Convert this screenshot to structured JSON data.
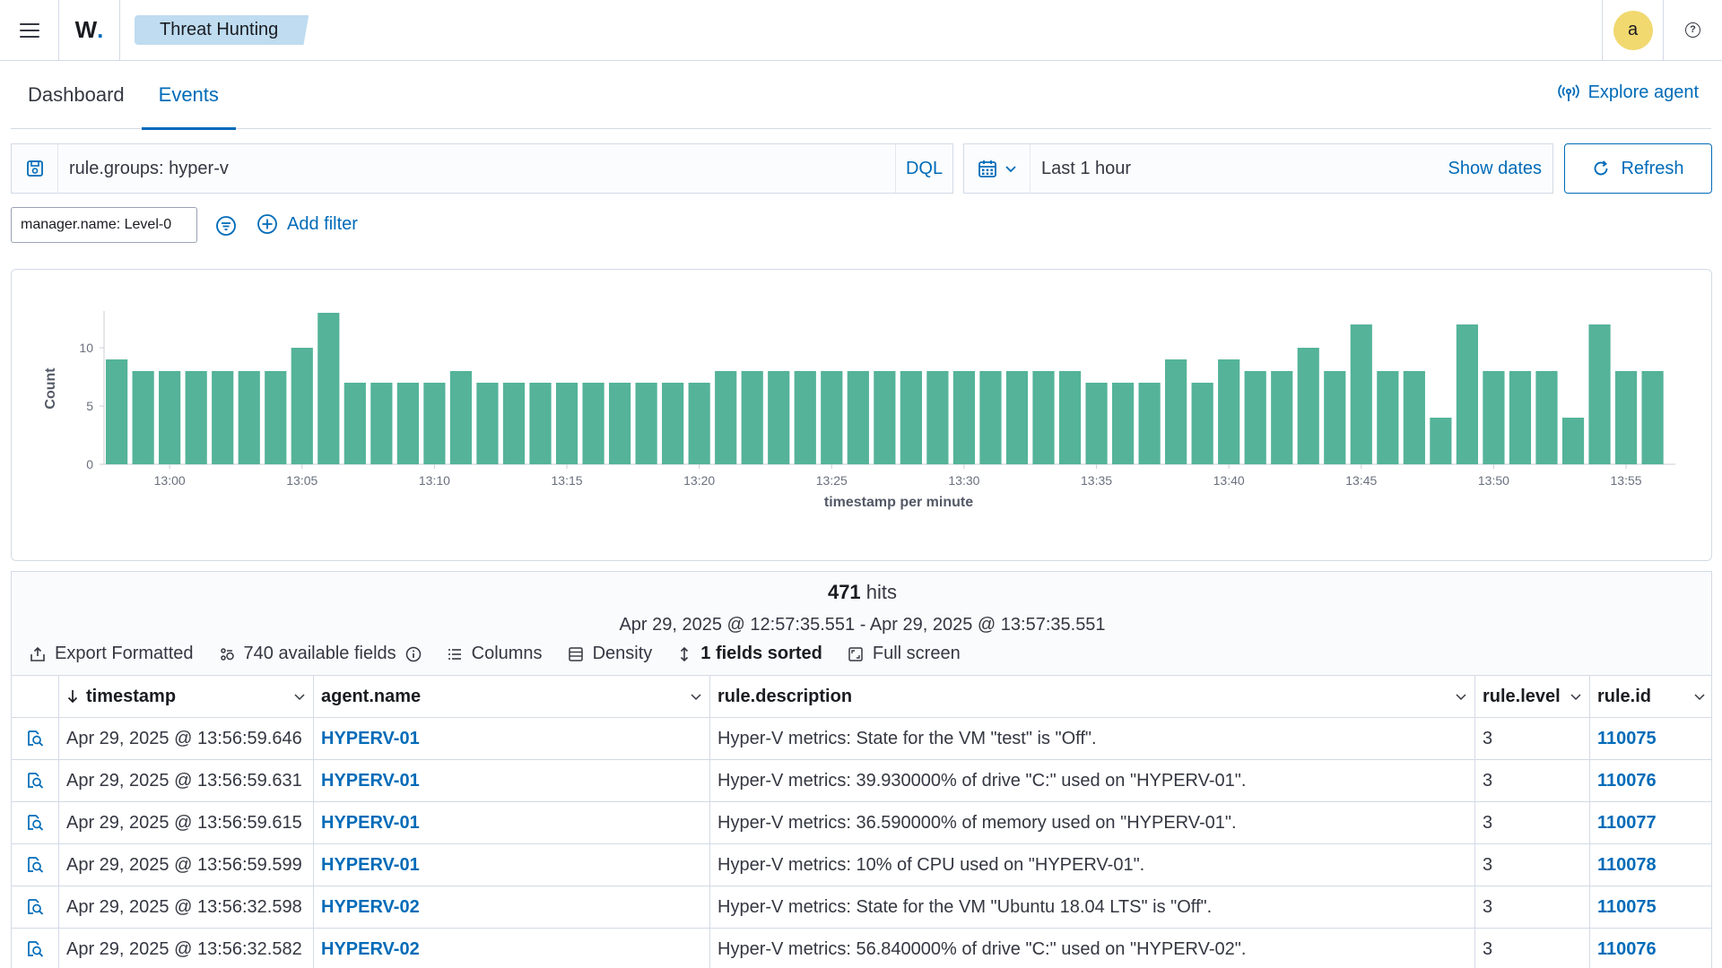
{
  "header": {
    "logo_text": "W",
    "logo_dot": ".",
    "breadcrumb": "Threat Hunting",
    "avatar_letter": "a",
    "help_glyph": "?"
  },
  "tabs": [
    {
      "label": "Dashboard",
      "active": false
    },
    {
      "label": "Events",
      "active": true
    }
  ],
  "explore_agent": "Explore agent",
  "query": {
    "value": "rule.groups: hyper-v",
    "language": "DQL"
  },
  "date_picker": {
    "range": "Last 1 hour",
    "show_dates": "Show dates"
  },
  "refresh_label": "Refresh",
  "filters": {
    "pill": "manager.name: Level-0",
    "add_filter": "Add filter"
  },
  "chart_data": {
    "type": "bar",
    "xlabel": "timestamp per minute",
    "ylabel": "Count",
    "ylim": [
      0,
      13
    ],
    "yticks": [
      0,
      5,
      10
    ],
    "x_tick_labels": [
      "13:00",
      "13:05",
      "13:10",
      "13:15",
      "13:20",
      "13:25",
      "13:30",
      "13:35",
      "13:40",
      "13:45",
      "13:50",
      "13:55"
    ],
    "x_start_minute": "12:58",
    "values": [
      9,
      8,
      8,
      8,
      8,
      8,
      8,
      10,
      13,
      7,
      7,
      7,
      7,
      8,
      7,
      7,
      7,
      7,
      7,
      7,
      7,
      7,
      7,
      8,
      8,
      8,
      8,
      8,
      8,
      8,
      8,
      8,
      8,
      8,
      8,
      8,
      8,
      7,
      7,
      7,
      9,
      7,
      9,
      8,
      8,
      10,
      8,
      12,
      8,
      8,
      4,
      12,
      8,
      8,
      8,
      4,
      12,
      8,
      8
    ],
    "bar_color": "#54b399",
    "grid": false
  },
  "results": {
    "hits_count": "471",
    "hits_label": "hits",
    "time_range": "Apr 29, 2025 @ 12:57:35.551 - Apr 29, 2025 @ 13:57:35.551",
    "toolbar": {
      "export": "Export Formatted",
      "fields": "740 available fields",
      "columns": "Columns",
      "density": "Density",
      "sorted": "1 fields sorted",
      "fullscreen": "Full screen"
    },
    "columns": [
      "timestamp",
      "agent.name",
      "rule.description",
      "rule.level",
      "rule.id"
    ],
    "rows": [
      {
        "timestamp": "Apr 29, 2025 @ 13:56:59.646",
        "agent": "HYPERV-01",
        "description": "Hyper-V metrics: State for the VM \"test\" is \"Off\".",
        "level": "3",
        "id": "110075"
      },
      {
        "timestamp": "Apr 29, 2025 @ 13:56:59.631",
        "agent": "HYPERV-01",
        "description": "Hyper-V metrics: 39.930000% of drive \"C:\" used on \"HYPERV-01\".",
        "level": "3",
        "id": "110076"
      },
      {
        "timestamp": "Apr 29, 2025 @ 13:56:59.615",
        "agent": "HYPERV-01",
        "description": "Hyper-V metrics: 36.590000% of memory used on \"HYPERV-01\".",
        "level": "3",
        "id": "110077"
      },
      {
        "timestamp": "Apr 29, 2025 @ 13:56:59.599",
        "agent": "HYPERV-01",
        "description": "Hyper-V metrics: 10% of CPU used on \"HYPERV-01\".",
        "level": "3",
        "id": "110078"
      },
      {
        "timestamp": "Apr 29, 2025 @ 13:56:32.598",
        "agent": "HYPERV-02",
        "description": "Hyper-V metrics: State for the VM \"Ubuntu 18.04 LTS\" is \"Off\".",
        "level": "3",
        "id": "110075"
      },
      {
        "timestamp": "Apr 29, 2025 @ 13:56:32.582",
        "agent": "HYPERV-02",
        "description": "Hyper-V metrics: 56.840000% of drive \"C:\" used on \"HYPERV-02\".",
        "level": "3",
        "id": "110076"
      }
    ]
  },
  "colors": {
    "accent": "#006bb8",
    "breadcrumb_bg": "#bfdcf0",
    "avatar_bg": "#f1d86f",
    "bar": "#54b399"
  }
}
